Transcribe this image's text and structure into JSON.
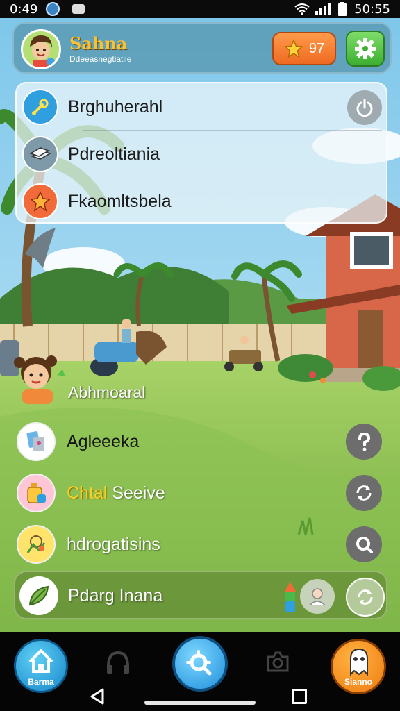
{
  "status_bar": {
    "time_left": "0:49",
    "time_right": "50:55"
  },
  "header": {
    "user_name": "Sahna",
    "user_subtitle": "Ddeeasnegtiatiie",
    "coin_count": "97"
  },
  "top_menu": {
    "items": [
      {
        "label": "Brghuherahl",
        "icon": "wrench-icon",
        "icon_color": "#2f9fe0"
      },
      {
        "label": "Pdreoltiania",
        "icon": "stack-icon",
        "icon_color": "#7e9aa8"
      },
      {
        "label": "Fkaomltsbela",
        "icon": "star-icon",
        "icon_color": "#f06a3a"
      }
    ]
  },
  "character": {
    "label": "Abhmoaral"
  },
  "list": {
    "items": [
      {
        "label": "Agleeeka",
        "icon": "map-icon",
        "action_icon": "question-icon"
      },
      {
        "label_part1": "Chtal",
        "label_part2": "Seeive",
        "icon": "pot-icon",
        "action_icon": "refresh-icon"
      },
      {
        "label": "hdrogatisins",
        "icon": "palette-icon",
        "action_icon": "search-icon"
      },
      {
        "label": "Pdarg Inana",
        "icon": "leaf-icon",
        "action_icon": "refresh-icon"
      }
    ]
  },
  "bottom_nav": {
    "home_label": "Barma",
    "profile_label": "Sianno"
  },
  "colors": {
    "accent_orange": "#ef6a22",
    "accent_green": "#3cae31",
    "accent_blue": "#1e8fdc"
  }
}
